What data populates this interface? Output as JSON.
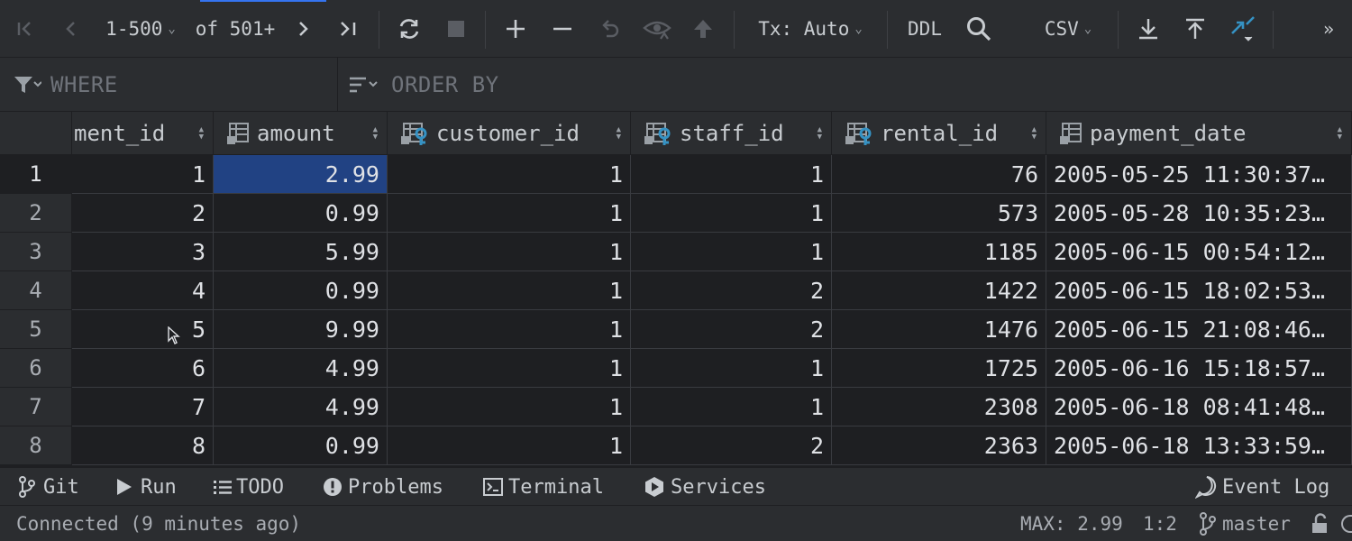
{
  "toolbar": {
    "page_range": "1-500",
    "page_of": "of 501+",
    "tx_mode": "Tx: Auto",
    "ddl_label": "DDL",
    "export_format": "CSV",
    "more_label": "»"
  },
  "filter": {
    "where_placeholder": "WHERE",
    "order_placeholder": "ORDER BY"
  },
  "columns": [
    {
      "name": "ment_id",
      "icon": "column-icon"
    },
    {
      "name": "amount",
      "icon": "column-icon"
    },
    {
      "name": "customer_id",
      "icon": "foreign-key-column-icon"
    },
    {
      "name": "staff_id",
      "icon": "foreign-key-column-icon"
    },
    {
      "name": "rental_id",
      "icon": "foreign-key-column-icon"
    },
    {
      "name": "payment_date",
      "icon": "column-icon"
    }
  ],
  "rows": [
    {
      "num": "1",
      "cells": [
        "1",
        "2.99",
        "1",
        "1",
        "76",
        "2005-05-25 11:30:37…"
      ]
    },
    {
      "num": "2",
      "cells": [
        "2",
        "0.99",
        "1",
        "1",
        "573",
        "2005-05-28 10:35:23…"
      ]
    },
    {
      "num": "3",
      "cells": [
        "3",
        "5.99",
        "1",
        "1",
        "1185",
        "2005-06-15 00:54:12…"
      ]
    },
    {
      "num": "4",
      "cells": [
        "4",
        "0.99",
        "1",
        "2",
        "1422",
        "2005-06-15 18:02:53…"
      ]
    },
    {
      "num": "5",
      "cells": [
        "5",
        "9.99",
        "1",
        "2",
        "1476",
        "2005-06-15 21:08:46…"
      ]
    },
    {
      "num": "6",
      "cells": [
        "6",
        "4.99",
        "1",
        "1",
        "1725",
        "2005-06-16 15:18:57…"
      ]
    },
    {
      "num": "7",
      "cells": [
        "7",
        "4.99",
        "1",
        "1",
        "2308",
        "2005-06-18 08:41:48…"
      ]
    },
    {
      "num": "8",
      "cells": [
        "8",
        "0.99",
        "1",
        "2",
        "2363",
        "2005-06-18 13:33:59…"
      ]
    }
  ],
  "selected_cell": {
    "row": "1",
    "column": "amount"
  },
  "tool_windows": [
    {
      "label": "Git",
      "icon": "git-branch-icon"
    },
    {
      "label": "Run",
      "icon": "play-icon"
    },
    {
      "label": "TODO",
      "icon": "list-icon"
    },
    {
      "label": "Problems",
      "icon": "problems-icon"
    },
    {
      "label": "Terminal",
      "icon": "terminal-icon"
    },
    {
      "label": "Services",
      "icon": "services-icon"
    },
    {
      "label": "Event Log",
      "icon": "event-log-icon"
    }
  ],
  "status": {
    "connection": "Connected (9 minutes ago)",
    "aggregate": "MAX: 2.99",
    "position": "1:2",
    "branch": "master"
  },
  "colors": {
    "selection": "#214283",
    "accent": "#3574f0",
    "key_icon": "#3592c4"
  }
}
